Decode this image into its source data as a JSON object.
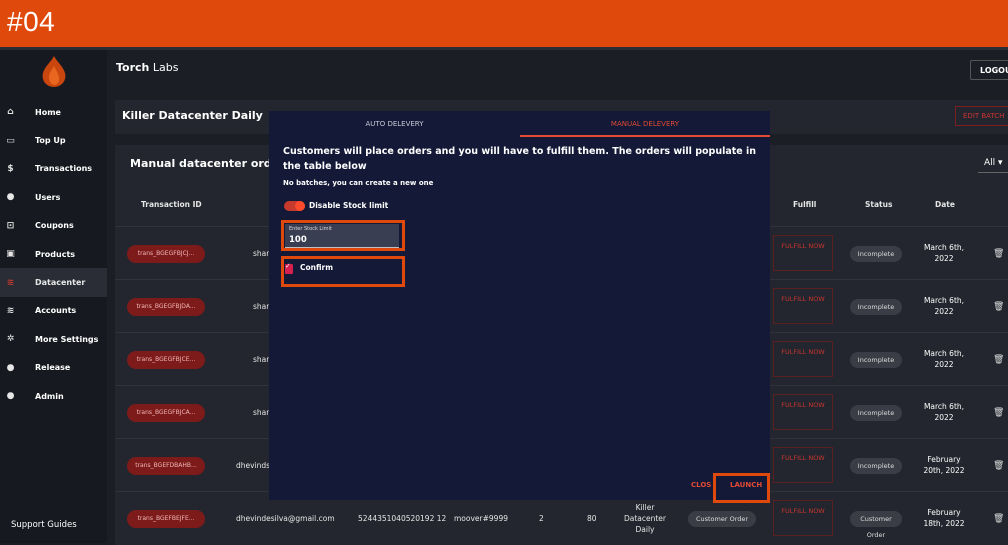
{
  "banner": {
    "text": "#04"
  },
  "colors": {
    "banner": "#e0490c",
    "accent": "#e24a34",
    "modal_bg": "#131936",
    "tid_pill": "#7d1b1b"
  },
  "header": {
    "brand_bold": "Torch",
    "brand_rest": " Labs",
    "logout": "LOGOUT"
  },
  "sidebar": {
    "items": [
      {
        "label": "Home",
        "icon": "home-icon",
        "glyph": "⌂"
      },
      {
        "label": "Top Up",
        "icon": "wallet-icon",
        "glyph": "▭"
      },
      {
        "label": "Transactions",
        "icon": "dollar-icon",
        "glyph": "$"
      },
      {
        "label": "Users",
        "icon": "user-icon",
        "glyph": "●"
      },
      {
        "label": "Coupons",
        "icon": "coupon-icon",
        "glyph": "⊡"
      },
      {
        "label": "Products",
        "icon": "briefcase-icon",
        "glyph": "▣"
      },
      {
        "label": "Datacenter",
        "icon": "wifi-icon",
        "glyph": "≋"
      },
      {
        "label": "Accounts",
        "icon": "wifi-icon",
        "glyph": "≋"
      },
      {
        "label": "More Settings",
        "icon": "gear-icon",
        "glyph": "✲"
      },
      {
        "label": "Release",
        "icon": "info-icon",
        "glyph": "●"
      },
      {
        "label": "Admin",
        "icon": "info-icon",
        "glyph": "●"
      }
    ],
    "support": "Support Guides"
  },
  "title_panel": {
    "title": "Killer Datacenter Daily",
    "edit_batch": "EDIT BATCH"
  },
  "orders": {
    "title": "Manual datacenter orders t",
    "filter": "All",
    "headers": {
      "transaction_id": "Transaction ID",
      "fulfill": "Fulfill",
      "status": "Status",
      "date": "Date"
    },
    "rows": [
      {
        "tid": "trans_BGEGFBJCJ...",
        "user": "shari",
        "fulfill": "FULFILL NOW",
        "status": "Incomplete",
        "date": "March 6th, 2022"
      },
      {
        "tid": "trans_BGEGFBJDA...",
        "user": "shari",
        "fulfill": "FULFILL NOW",
        "status": "Incomplete",
        "date": "March 6th, 2022"
      },
      {
        "tid": "trans_BGEGFBJCE...",
        "user": "shari",
        "fulfill": "FULFILL NOW",
        "status": "Incomplete",
        "date": "March 6th, 2022"
      },
      {
        "tid": "trans_BGEGFBJCA...",
        "user": "shari",
        "fulfill": "FULFILL NOW",
        "status": "Incomplete",
        "date": "March 6th, 2022"
      },
      {
        "tid": "trans_BGEFDBAHB...",
        "user": "dhevinds",
        "fulfill": "FULFILL NOW",
        "status": "Incomplete",
        "date": "February 20th, 2022"
      },
      {
        "tid": "trans_BGEFBEJFE...",
        "user": "dhevindesilva@gmail.com",
        "card": "5244351040520192 12",
        "account": "moover#9999",
        "qty": "2",
        "gb": "80",
        "product": "Killer Datacenter Daily",
        "fulfill": "FULFILL NOW",
        "status": "Customer Order",
        "date": "February 18th, 2022"
      }
    ]
  },
  "modal": {
    "tab_auto": "AUTO DELEVERY",
    "tab_manual": "MANUAL DELEVERY",
    "heading": "Customers will place orders and you will have to fulfill them. The orders will populate in the table below",
    "sub": "No batches, you can create a new one",
    "toggle_label": "Disable Stock limit",
    "stock_placeholder": "Enter Stock Limit",
    "stock_value": "100",
    "confirm_label": "Confirm",
    "close": "CLOSE",
    "launch": "LAUNCH"
  }
}
